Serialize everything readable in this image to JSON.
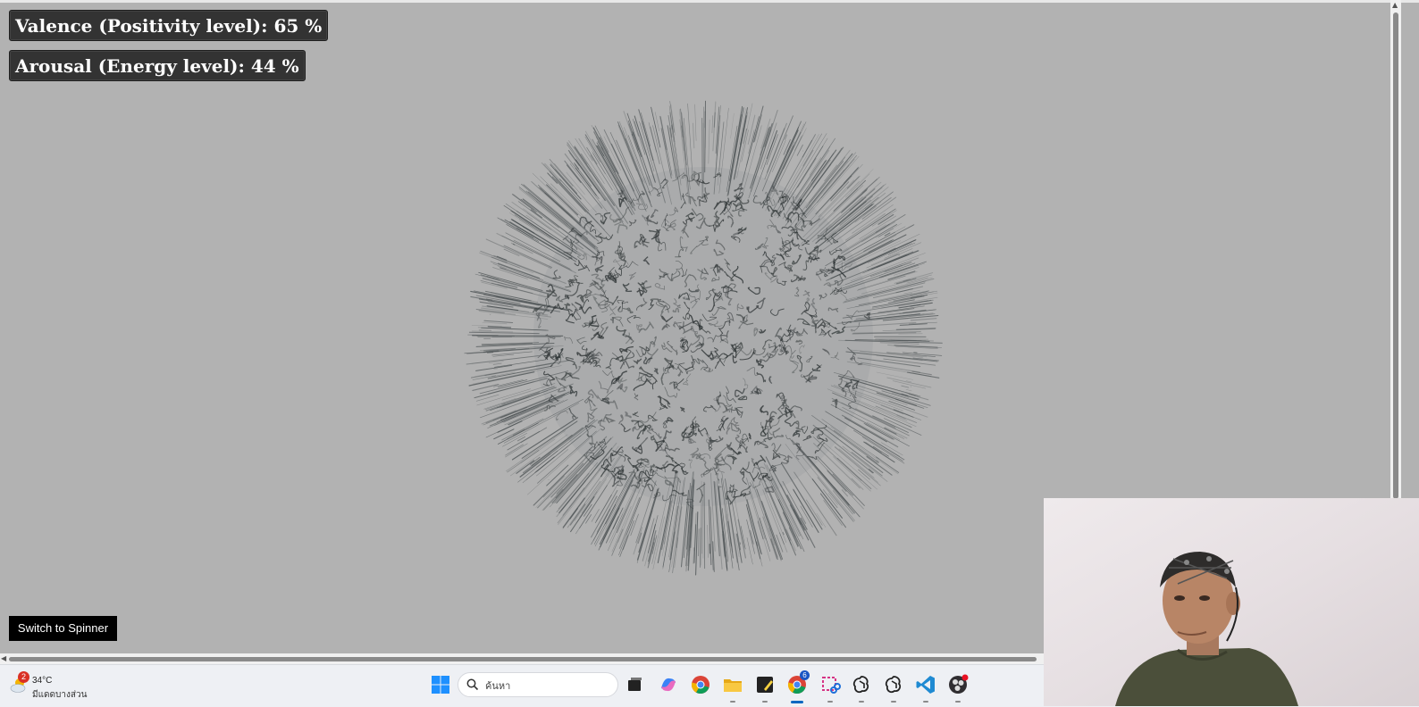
{
  "indicators": {
    "valence": "Valence (Positivity level): 65 %",
    "arousal": "Arousal (Energy level): 44 %"
  },
  "switch_button_label": "Switch to Spinner",
  "taskbar": {
    "weather": {
      "badge": "2",
      "temperature": "34°C",
      "description": "มีแดดบางส่วน"
    },
    "search_placeholder": "ค้นหา",
    "chrome_badge": "6",
    "icons": [
      "windows-start-icon",
      "search-icon",
      "task-view-icon",
      "copilot-icon",
      "chrome-icon",
      "file-explorer-icon",
      "sticky-notes-icon",
      "chrome-profile-icon",
      "snipping-tool-icon",
      "chatgpt-icon",
      "chatgpt-icon",
      "vscode-icon",
      "obs-icon"
    ]
  },
  "colors": {
    "background": "#b2b2b2",
    "badge_bg": "#333333",
    "button_bg": "#000000"
  }
}
